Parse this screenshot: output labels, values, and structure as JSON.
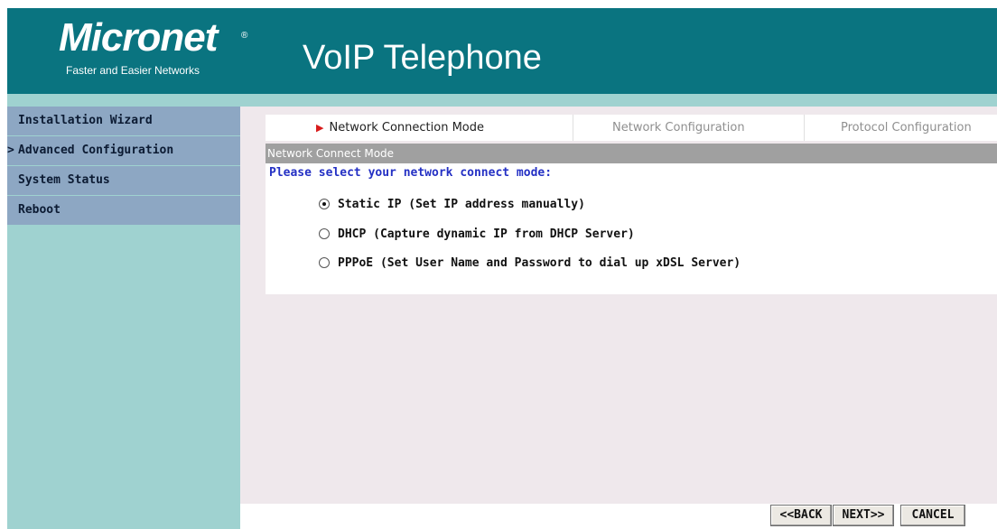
{
  "header": {
    "brand": "Micronet",
    "brand_mark": "®",
    "tagline": "Faster and Easier Networks",
    "title": "VoIP Telephone",
    "bg_color": "#0a7480"
  },
  "sidebar": {
    "items": [
      {
        "label": "Installation Wizard",
        "active": false
      },
      {
        "label": "Advanced Configuration",
        "active": true,
        "marker": ">"
      },
      {
        "label": "System Status",
        "active": false
      },
      {
        "label": "Reboot",
        "active": false
      }
    ]
  },
  "wizard": {
    "steps": [
      {
        "label": "Network Connection Mode",
        "current": true,
        "pointer": "▶"
      },
      {
        "label": "Network Configuration",
        "current": false
      },
      {
        "label": "Protocol Configuration",
        "current": false
      }
    ],
    "section_title": "Network Connect Mode",
    "prompt": "Please select your network connect mode:",
    "options": [
      {
        "label": "Static IP (Set IP address manually)",
        "checked": true
      },
      {
        "label": "DHCP (Capture dynamic IP from DHCP Server)",
        "checked": false
      },
      {
        "label": "PPPoE (Set User Name and Password to dial up xDSL Server)",
        "checked": false
      }
    ]
  },
  "buttons": {
    "back": "<<BACK",
    "next": "NEXT>>",
    "cancel": "CANCEL"
  },
  "colors": {
    "sidebar_item": "#8da7c3",
    "sidebar_bg": "#9fd2d0",
    "prompt_text": "#2430c4",
    "current_step_pointer": "#d81b1b"
  }
}
